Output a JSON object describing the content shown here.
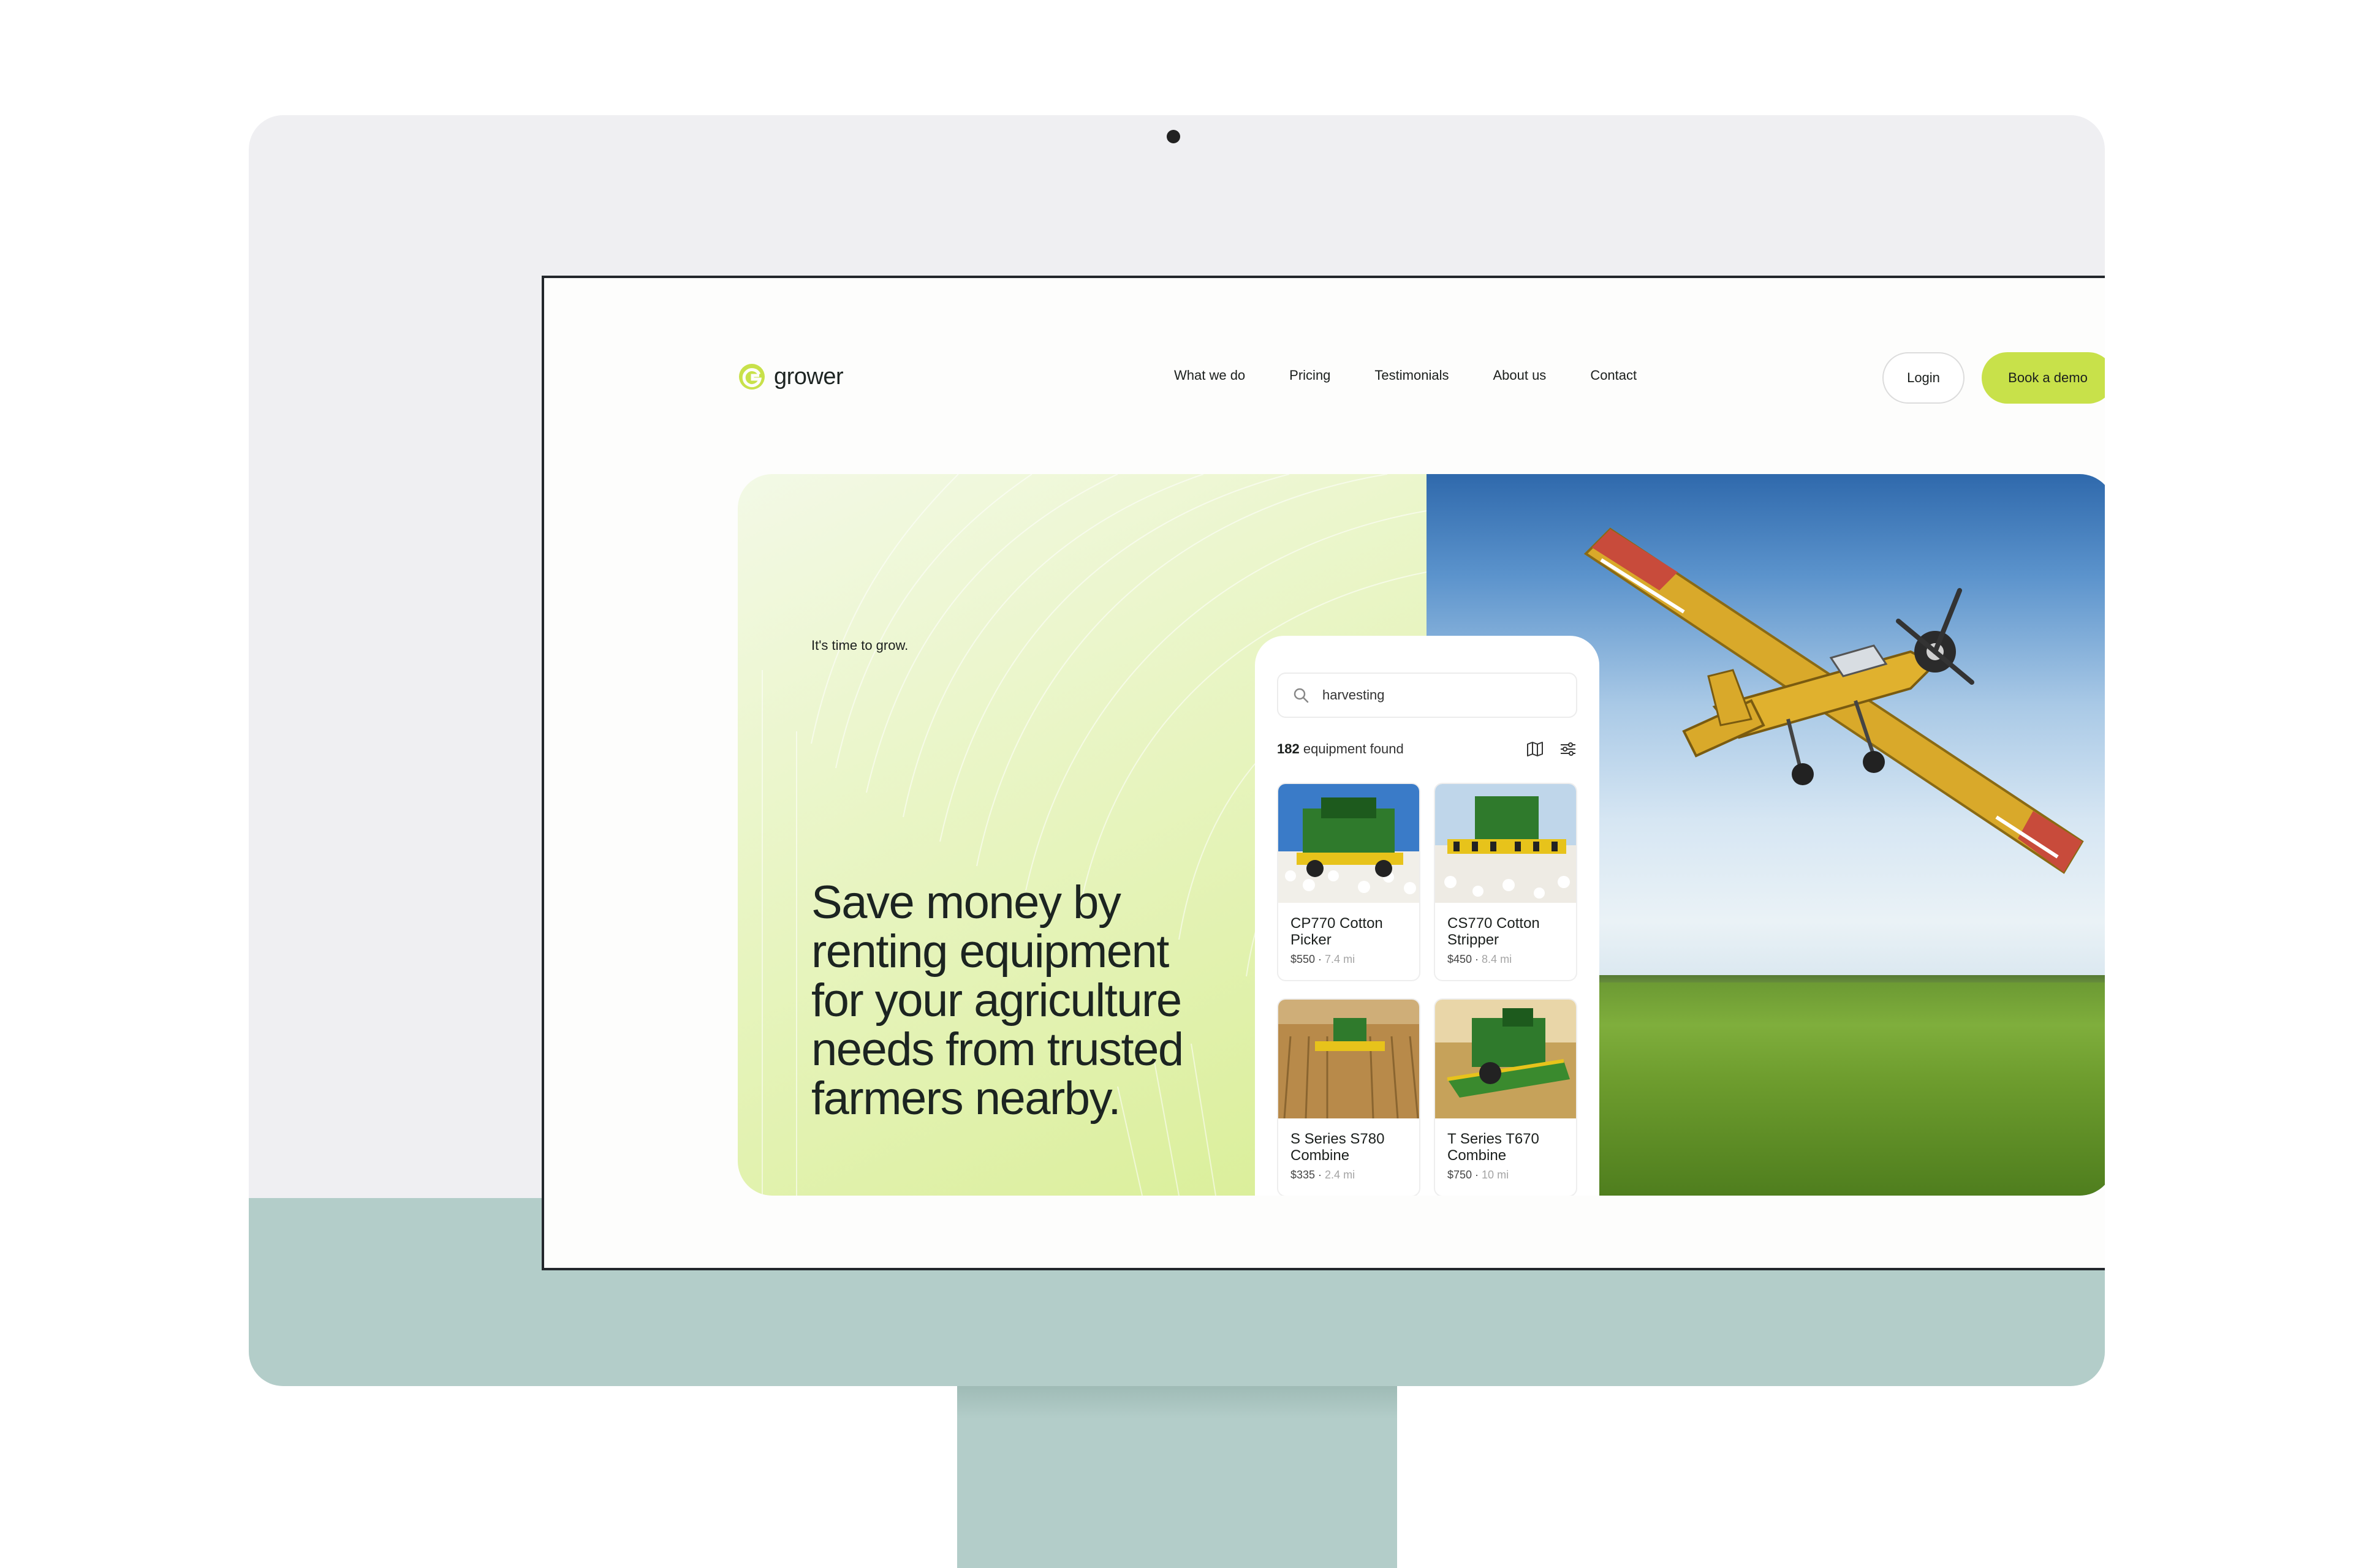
{
  "brand": {
    "name": "grower",
    "accent": "#c8e14a"
  },
  "nav": {
    "items": [
      "What we do",
      "Pricing",
      "Testimonials",
      "About us",
      "Contact"
    ],
    "login_label": "Login",
    "demo_label": "Book a demo"
  },
  "hero": {
    "tagline": "It's time to grow.",
    "headline": "Save money by renting equipment for your agriculture needs from trusted farmers nearby."
  },
  "search": {
    "value": "harvesting",
    "results_count": "182",
    "results_label": " equipment found"
  },
  "equipment": [
    {
      "name": "CP770 Cotton Picker",
      "price": "$550",
      "distance": "7.4 mi"
    },
    {
      "name": "CS770 Cotton Stripper",
      "price": "$450",
      "distance": "8.4 mi"
    },
    {
      "name": "S Series S780 Combine",
      "price": "$335",
      "distance": "2.4 mi"
    },
    {
      "name": "T Series T670 Combine",
      "price": "$750",
      "distance": "10 mi"
    }
  ],
  "icons": [
    "logo-mark-icon",
    "search-icon",
    "map-icon",
    "filter-icon",
    "camera-icon"
  ]
}
